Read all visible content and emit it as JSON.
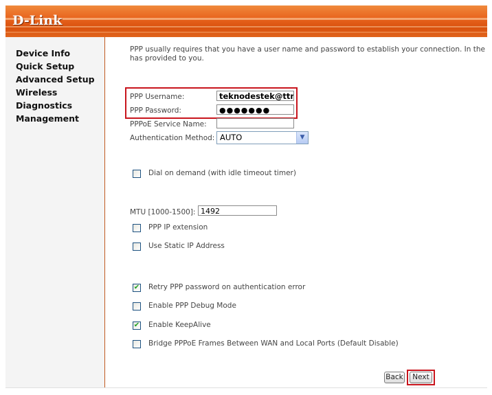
{
  "header": {
    "logo": "D-Link"
  },
  "sidebar": {
    "items": [
      {
        "label": "Device Info"
      },
      {
        "label": "Quick Setup"
      },
      {
        "label": "Advanced Setup"
      },
      {
        "label": "Wireless"
      },
      {
        "label": "Diagnostics"
      },
      {
        "label": "Management"
      }
    ]
  },
  "main": {
    "intro_line1": "PPP usually requires that you have a user name and password to establish your connection. In the box",
    "intro_line2": "has provided to you.",
    "username_label": "PPP Username:",
    "username_value": "teknodestek@ttnet",
    "password_label": "PPP Password:",
    "password_value": "●●●●●●●",
    "service_name_label": "PPPoE Service Name:",
    "service_name_value": "",
    "auth_label": "Authentication Method:",
    "auth_value": "AUTO",
    "dial_on_demand_label": "Dial on demand (with idle timeout timer)",
    "mtu_label": "MTU [1000-1500]:",
    "mtu_value": "1492",
    "ppp_ip_extension_label": "PPP IP extension",
    "static_ip_label": "Use Static IP Address",
    "retry_label": "Retry PPP password on authentication error",
    "debug_label": "Enable PPP Debug Mode",
    "keepalive_label": "Enable KeepAlive",
    "bridge_label": "Bridge PPPoE Frames Between WAN and Local Ports (Default Disable)",
    "checkboxes": {
      "dial_on_demand": false,
      "ppp_ip_extension": false,
      "static_ip": false,
      "retry": true,
      "debug": false,
      "keepalive": true,
      "bridge": false
    },
    "back_label": "Back",
    "next_label": "Next"
  },
  "colors": {
    "header_orange": "#e8641e",
    "highlight_red": "#c8141c",
    "check_green": "#21a121"
  }
}
